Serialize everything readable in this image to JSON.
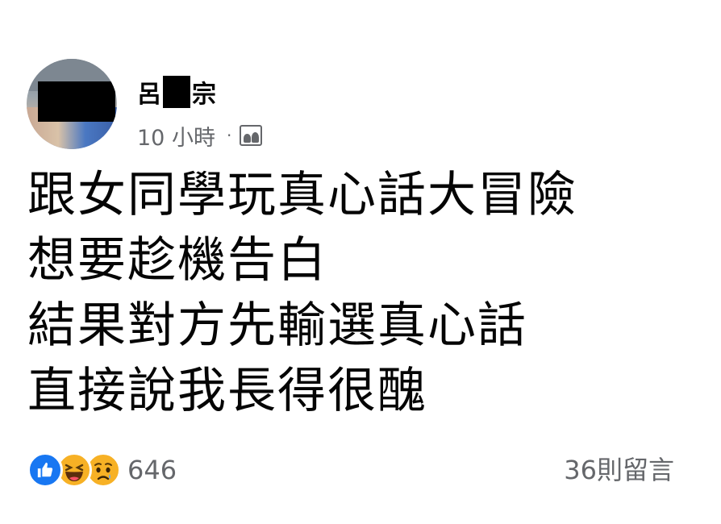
{
  "post": {
    "author": {
      "name_prefix": "呂",
      "name_suffix": "宗"
    },
    "timestamp": "10 小時",
    "separator": "·",
    "audience_icon": "friends-icon",
    "text_lines": [
      "跟女同學玩真心話大冒險",
      "想要趁機告白",
      "結果對方先輸選真心話",
      "直接說我長得很醜"
    ],
    "reactions": {
      "types": [
        "like-icon",
        "haha-icon",
        "sad-icon"
      ],
      "count": "646"
    },
    "comments_label": "36則留言"
  },
  "colors": {
    "like": "#1877f2",
    "emoji": "#f7b125",
    "muted": "#65676b",
    "text": "#050505"
  }
}
